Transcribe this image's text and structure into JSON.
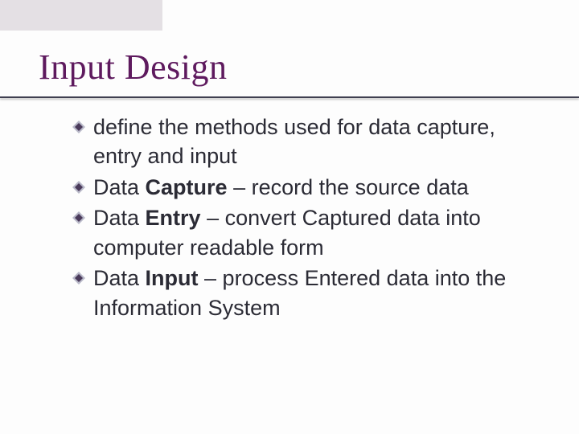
{
  "title": "Input Design",
  "bullets": [
    {
      "html": "define the methods used for data capture, entry and input"
    },
    {
      "html": "Data <b>Capture</b> – record the source data"
    },
    {
      "html": "Data <b>Entry</b> – convert Captured data into computer readable form"
    },
    {
      "html": "Data <b>Input</b> – process Entered data into the Information System"
    }
  ]
}
